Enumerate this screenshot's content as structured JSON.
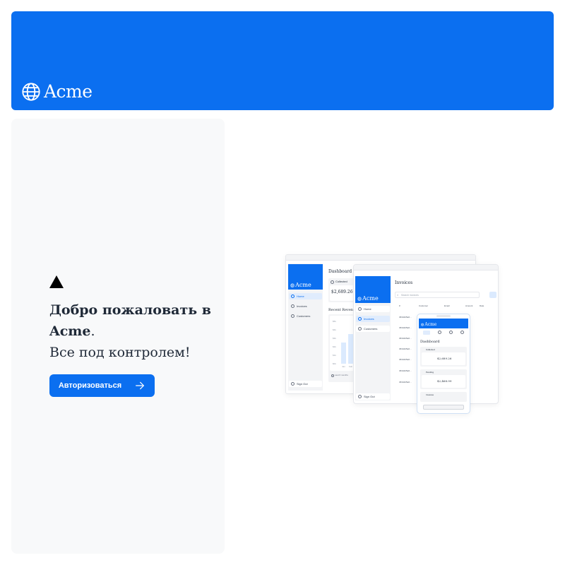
{
  "header": {
    "logo_text": "Acme"
  },
  "welcome": {
    "heading_prefix": "Добро пожаловать в ",
    "heading_brand": "Acme",
    "heading_suffix": ".",
    "subtitle": "Все под контролем!",
    "login_button": "Авторизоваться"
  },
  "hero": {
    "desktop": {
      "logo_text": "Acme",
      "nav": [
        "Home",
        "Invoices",
        "Customers"
      ],
      "sign_out": "Sign Out",
      "title": "Dashboard",
      "card_label": "Collected",
      "card_value": "$2,689.26",
      "revenue_title": "Recent Revenue",
      "y_ticks": [
        "$5k",
        "$4k",
        "$3k",
        "$2k",
        "$1k",
        "$0k"
      ],
      "x_ticks": [
        "Jan",
        "Feb"
      ],
      "footer": "Last 6 months"
    },
    "tablet": {
      "logo_text": "Acme",
      "nav": [
        "Home",
        "Invoices",
        "Customers"
      ],
      "sign_out": "Sign Out",
      "title": "Invoices",
      "search_placeholder": "Search invoices",
      "columns": [
        "Customer",
        "Email",
        "Amount",
        "Date"
      ],
      "rows": [
        "3634425a6…",
        "3634425a6…",
        "3634425a6…",
        "3634425a6…",
        "3634425a6…",
        "3634425a6…",
        "3634425a6…"
      ]
    },
    "mobile": {
      "logo_text": "Acme",
      "title": "Dashboard",
      "cards": [
        {
          "label": "Collected",
          "value": "$2,689.26"
        },
        {
          "label": "Pending",
          "value": "$2,468.99"
        },
        {
          "label": "Invoices",
          "value": ""
        }
      ]
    }
  }
}
